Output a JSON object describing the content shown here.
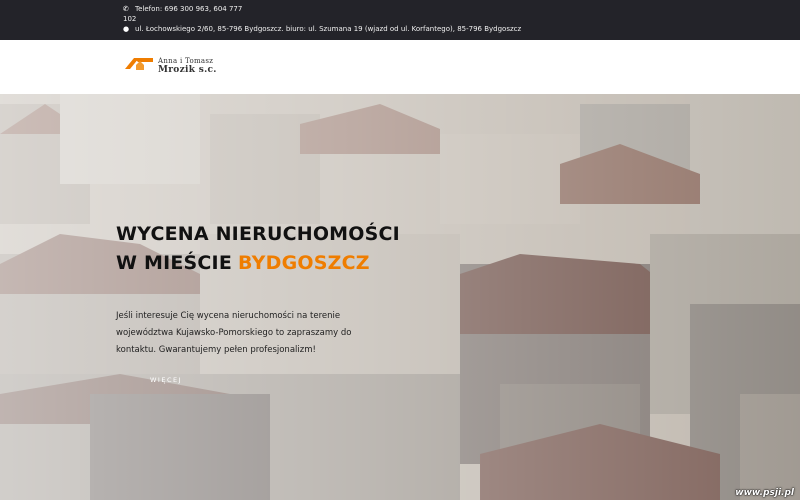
{
  "topbar": {
    "phone_line1": "Telefon: 696 300 963, 604 777",
    "phone_line2": "102",
    "address": "ul. Łochowskiego 2/60, 85-796 Bydgoszcz. biuro: ul. Szumana 19 (wjazd od ul. Korfantego), 85-796 Bydgoszcz",
    "phone_icon": "phone-icon",
    "pin_icon": "map-pin-icon"
  },
  "logo": {
    "line1": "Anna i Tomasz",
    "line2": "Mrozik s.c.",
    "brand_color": "#ef7d00"
  },
  "hero": {
    "title_line1": "WYCENA NIERUCHOMOŚCI",
    "title_line2": "W MIEŚCIE",
    "city": "BYDGOSZCZ",
    "description": "Jeśli interesuje Cię wycena nieruchomości na terenie województwa Kujawsko-Pomorskiego to zapraszamy do kontaktu. Gwarantujemy pełen profesjonalizm!",
    "more_label": "WIĘCEJ"
  },
  "watermark": "www.psji.pl"
}
